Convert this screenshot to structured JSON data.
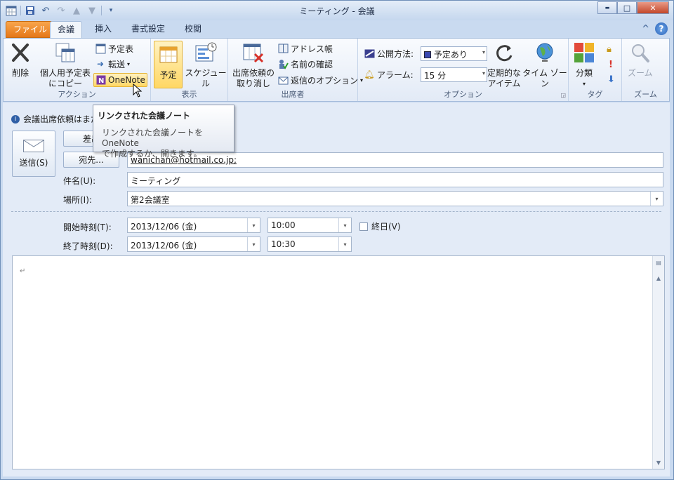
{
  "window": {
    "title": "ミーティング - 会議",
    "controls": {
      "minimize": "▬",
      "maximize": "□",
      "close": "✕"
    }
  },
  "quick_access": {
    "icons": [
      "calendar-icon",
      "save-icon",
      "undo-icon",
      "redo-icon",
      "up-arrow-icon",
      "down-arrow-icon",
      "customize-icon"
    ]
  },
  "tabs": {
    "file": "ファイル",
    "items": [
      "会議",
      "挿入",
      "書式設定",
      "校閲"
    ],
    "active": "会議",
    "collapse": "^",
    "help": "?"
  },
  "ribbon": {
    "actions": {
      "label": "アクション",
      "delete": "削除",
      "copy_line1": "個人用予定表",
      "copy_line2": "にコピー",
      "calendar": "予定表",
      "forward": "転送",
      "onenote": "OneNote"
    },
    "show": {
      "label": "表示",
      "appointment": "予定",
      "schedule": "スケジュール"
    },
    "attendees": {
      "label": "出席者",
      "cancel_line1": "出席依頼の",
      "cancel_line2": "取り消し",
      "address_book": "アドレス帳",
      "check_names": "名前の確認",
      "response_options": "返信のオプション"
    },
    "options": {
      "label": "オプション",
      "show_as_label": "公開方法:",
      "show_as_value": "予定あり",
      "reminder_label": "アラーム:",
      "reminder_value": "15 分",
      "recurrence_line1": "定期的な",
      "recurrence_line2": "アイテム",
      "timezone": "タイム ゾーン"
    },
    "tags": {
      "label": "タグ",
      "categorize": "分類"
    },
    "zoom": {
      "label": "ズーム",
      "zoom": "ズーム"
    }
  },
  "infobar": {
    "text": "会議出席依頼はまだ"
  },
  "form": {
    "send": "送信(S)",
    "from": "差出",
    "to_button": "宛先...",
    "to_value": "wanichan@hotmail.co.jp;",
    "subject_label": "件名(U):",
    "subject_value": "ミーティング",
    "location_label": "場所(I):",
    "location_value": "第2会議室",
    "start_label": "開始時刻(T):",
    "start_date": "2013/12/06 (金)",
    "start_time": "10:00",
    "allday_label": "終日(V)",
    "end_label": "終了時刻(D):",
    "end_date": "2013/12/06 (金)",
    "end_time": "10:30",
    "paragraph_mark": "↵"
  },
  "tooltip": {
    "title": "リンクされた会議ノート",
    "line1": "リンクされた会議ノートを OneNote",
    "line2": "で作成するか、開きます。"
  },
  "colors": {
    "accent_orange": "#e57719",
    "ribbon_bg": "#e2eaf6",
    "highlight": "#ffd764",
    "frame": "#c9daf0"
  }
}
